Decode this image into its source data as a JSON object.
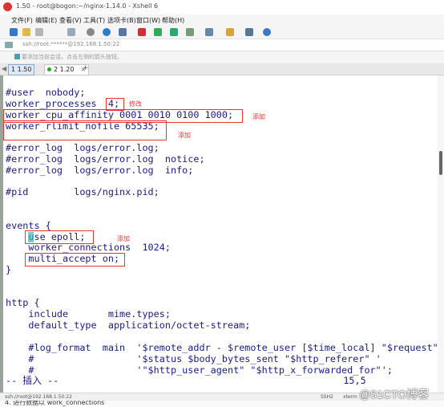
{
  "window": {
    "title": "1.50 - root@bogon:~/nginx-1.14.0 - Xshell 6"
  },
  "menu": [
    "文件(F)",
    "编辑(E)",
    "查看(V)",
    "工具(T)",
    "选项卡(B)",
    "窗口(W)",
    "帮助(H)"
  ],
  "address": {
    "text": "ssh://root:******@192.168.1.50:22"
  },
  "hint": {
    "text": "要添加当前会话，点击左侧的箭头按钮。"
  },
  "tabs": [
    {
      "label": "1 1.50"
    },
    {
      "label": "2 1.20"
    }
  ],
  "tab_add": "+",
  "tab_close": "×",
  "tab_nav": "◀ ▶",
  "terminal": {
    "lines": [
      {
        "text": "#user  nobody;"
      },
      {
        "text": "worker_processes  4;"
      },
      {
        "text": "worker_cpu_affinity 0001 0010 0100 1000;"
      },
      {
        "text": "worker_rlimit_nofile 65535;"
      },
      {
        "text": ""
      },
      {
        "text": "#error_log  logs/error.log;"
      },
      {
        "text": "#error_log  logs/error.log  notice;"
      },
      {
        "text": "#error_log  logs/error.log  info;"
      },
      {
        "text": ""
      },
      {
        "text": "#pid        logs/nginx.pid;"
      },
      {
        "text": ""
      },
      {
        "text": ""
      },
      {
        "text": "events {"
      },
      {
        "text": "    use epoll;"
      },
      {
        "text": "    worker_connections  1024;"
      },
      {
        "text": "    multi_accept on;"
      },
      {
        "text": "}"
      },
      {
        "text": ""
      },
      {
        "text": ""
      },
      {
        "text": "http {"
      },
      {
        "text": "    include       mime.types;"
      },
      {
        "text": "    default_type  application/octet-stream;"
      },
      {
        "text": ""
      },
      {
        "text": "    #log_format  main  '$remote_addr - $remote_user [$time_local] \"$request\" '"
      },
      {
        "text": "    #                  '$status $body_bytes_sent \"$http_referer\" '"
      },
      {
        "text": "    #                  '\"$http_user_agent\" \"$http_x_forwarded_for\"';"
      },
      {
        "text": "-- 插入 --                                                  15,5"
      }
    ],
    "annotations": {
      "modify": "修改",
      "add": "添加"
    }
  },
  "status": {
    "connection": "ssh://root@192.168.1.50:22",
    "protocol": "SSH2",
    "terminal": "xterm",
    "size": "77x27",
    "position": "15,5",
    "sessions": "1 会话"
  },
  "watermark": "@51CTO博客",
  "bottom": {
    "text": "4. 进行数据以 work_connections"
  },
  "colors": {
    "code": "#1a1a8a",
    "annotation": "#e33333",
    "active_tab": "#dfe9f5"
  },
  "icons": [
    "app-icon",
    "new-session-icon",
    "open-folder-icon",
    "disconnect-icon",
    "copy-icon",
    "search-icon",
    "globe-icon",
    "font-icon",
    "lock-icon",
    "fullscreen-icon",
    "layout-icon",
    "help-icon"
  ]
}
